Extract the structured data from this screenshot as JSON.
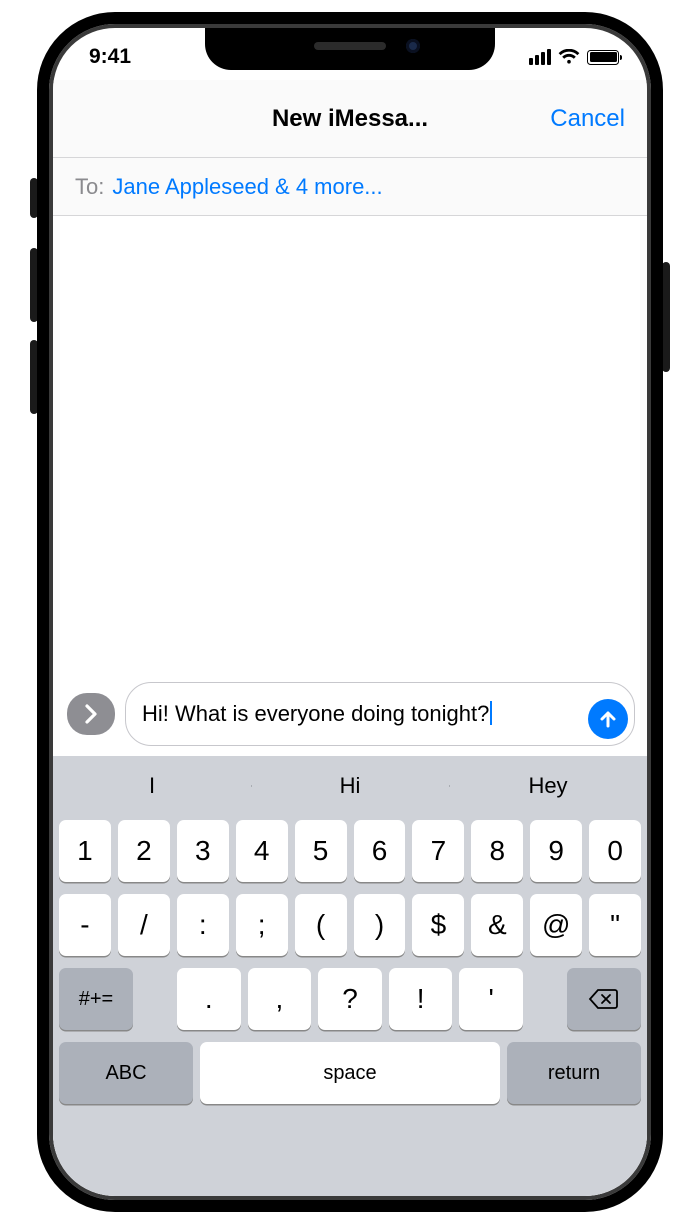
{
  "status": {
    "time": "9:41"
  },
  "nav": {
    "title": "New iMessa...",
    "cancel": "Cancel"
  },
  "to": {
    "label": "To:",
    "recipients": "Jane Appleseed & 4 more..."
  },
  "compose": {
    "text": "Hi! What is everyone doing tonight?"
  },
  "keyboard": {
    "predictions": [
      "I",
      "Hi",
      "Hey"
    ],
    "row1": [
      "1",
      "2",
      "3",
      "4",
      "5",
      "6",
      "7",
      "8",
      "9",
      "0"
    ],
    "row2": [
      "-",
      "/",
      ":",
      ";",
      "(",
      ")",
      "$",
      "&",
      "@",
      "\""
    ],
    "shift_label": "#+=",
    "row3": [
      ".",
      ",",
      "?",
      "!",
      "'"
    ],
    "abc_label": "ABC",
    "space_label": "space",
    "return_label": "return"
  }
}
